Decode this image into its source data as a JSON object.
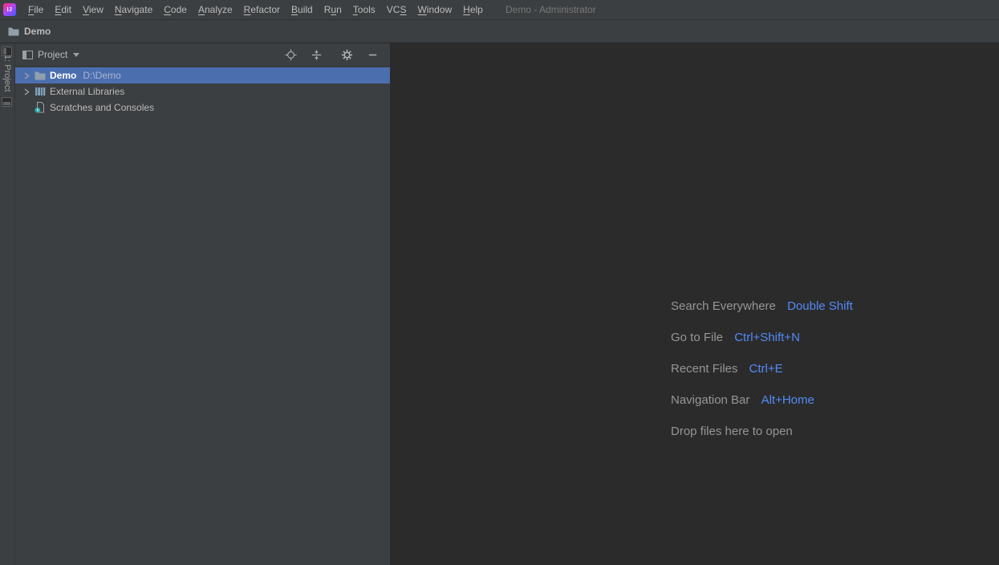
{
  "window": {
    "title": "Demo - Administrator",
    "logo_text": "IJ"
  },
  "menubar": {
    "items": [
      {
        "label": "File",
        "mnemonic_index": 0
      },
      {
        "label": "Edit",
        "mnemonic_index": 0
      },
      {
        "label": "View",
        "mnemonic_index": 0
      },
      {
        "label": "Navigate",
        "mnemonic_index": 0
      },
      {
        "label": "Code",
        "mnemonic_index": 0
      },
      {
        "label": "Analyze",
        "mnemonic_index": 0
      },
      {
        "label": "Refactor",
        "mnemonic_index": 0
      },
      {
        "label": "Build",
        "mnemonic_index": 0
      },
      {
        "label": "Run",
        "mnemonic_index": 1
      },
      {
        "label": "Tools",
        "mnemonic_index": 0
      },
      {
        "label": "VCS",
        "mnemonic_index": 2
      },
      {
        "label": "Window",
        "mnemonic_index": 0
      },
      {
        "label": "Help",
        "mnemonic_index": 0
      }
    ]
  },
  "navbar": {
    "breadcrumb": "Demo"
  },
  "left_stripe": {
    "project_button_label": "1: Project"
  },
  "project_panel": {
    "header": {
      "title": "Project",
      "toolbar_icons": [
        "locate-icon",
        "collapse-all-icon",
        "settings-icon",
        "hide-icon"
      ]
    },
    "tree": {
      "items": [
        {
          "name": "Demo",
          "path": "D:\\Demo",
          "selected": true,
          "has_chevron": true,
          "icon": "folder",
          "bold": true
        },
        {
          "name": "External Libraries",
          "path": "",
          "selected": false,
          "has_chevron": true,
          "icon": "libraries",
          "bold": false
        },
        {
          "name": "Scratches and Consoles",
          "path": "",
          "selected": false,
          "has_chevron": false,
          "icon": "scratches",
          "bold": false
        }
      ]
    }
  },
  "editor": {
    "hints": [
      {
        "action": "Search Everywhere",
        "shortcut": "Double Shift"
      },
      {
        "action": "Go to File",
        "shortcut": "Ctrl+Shift+N"
      },
      {
        "action": "Recent Files",
        "shortcut": "Ctrl+E"
      },
      {
        "action": "Navigation Bar",
        "shortcut": "Alt+Home"
      },
      {
        "action": "Drop files here to open",
        "shortcut": ""
      }
    ]
  },
  "colors": {
    "panel_bg": "#3c3f41",
    "editor_bg": "#2b2b2b",
    "selection_bg": "#4b6eaf",
    "text": "#bbbbbb",
    "muted_text": "#787878",
    "hint_text": "#949699",
    "shortcut_text": "#548af7",
    "path_text": "#aab6cf"
  }
}
